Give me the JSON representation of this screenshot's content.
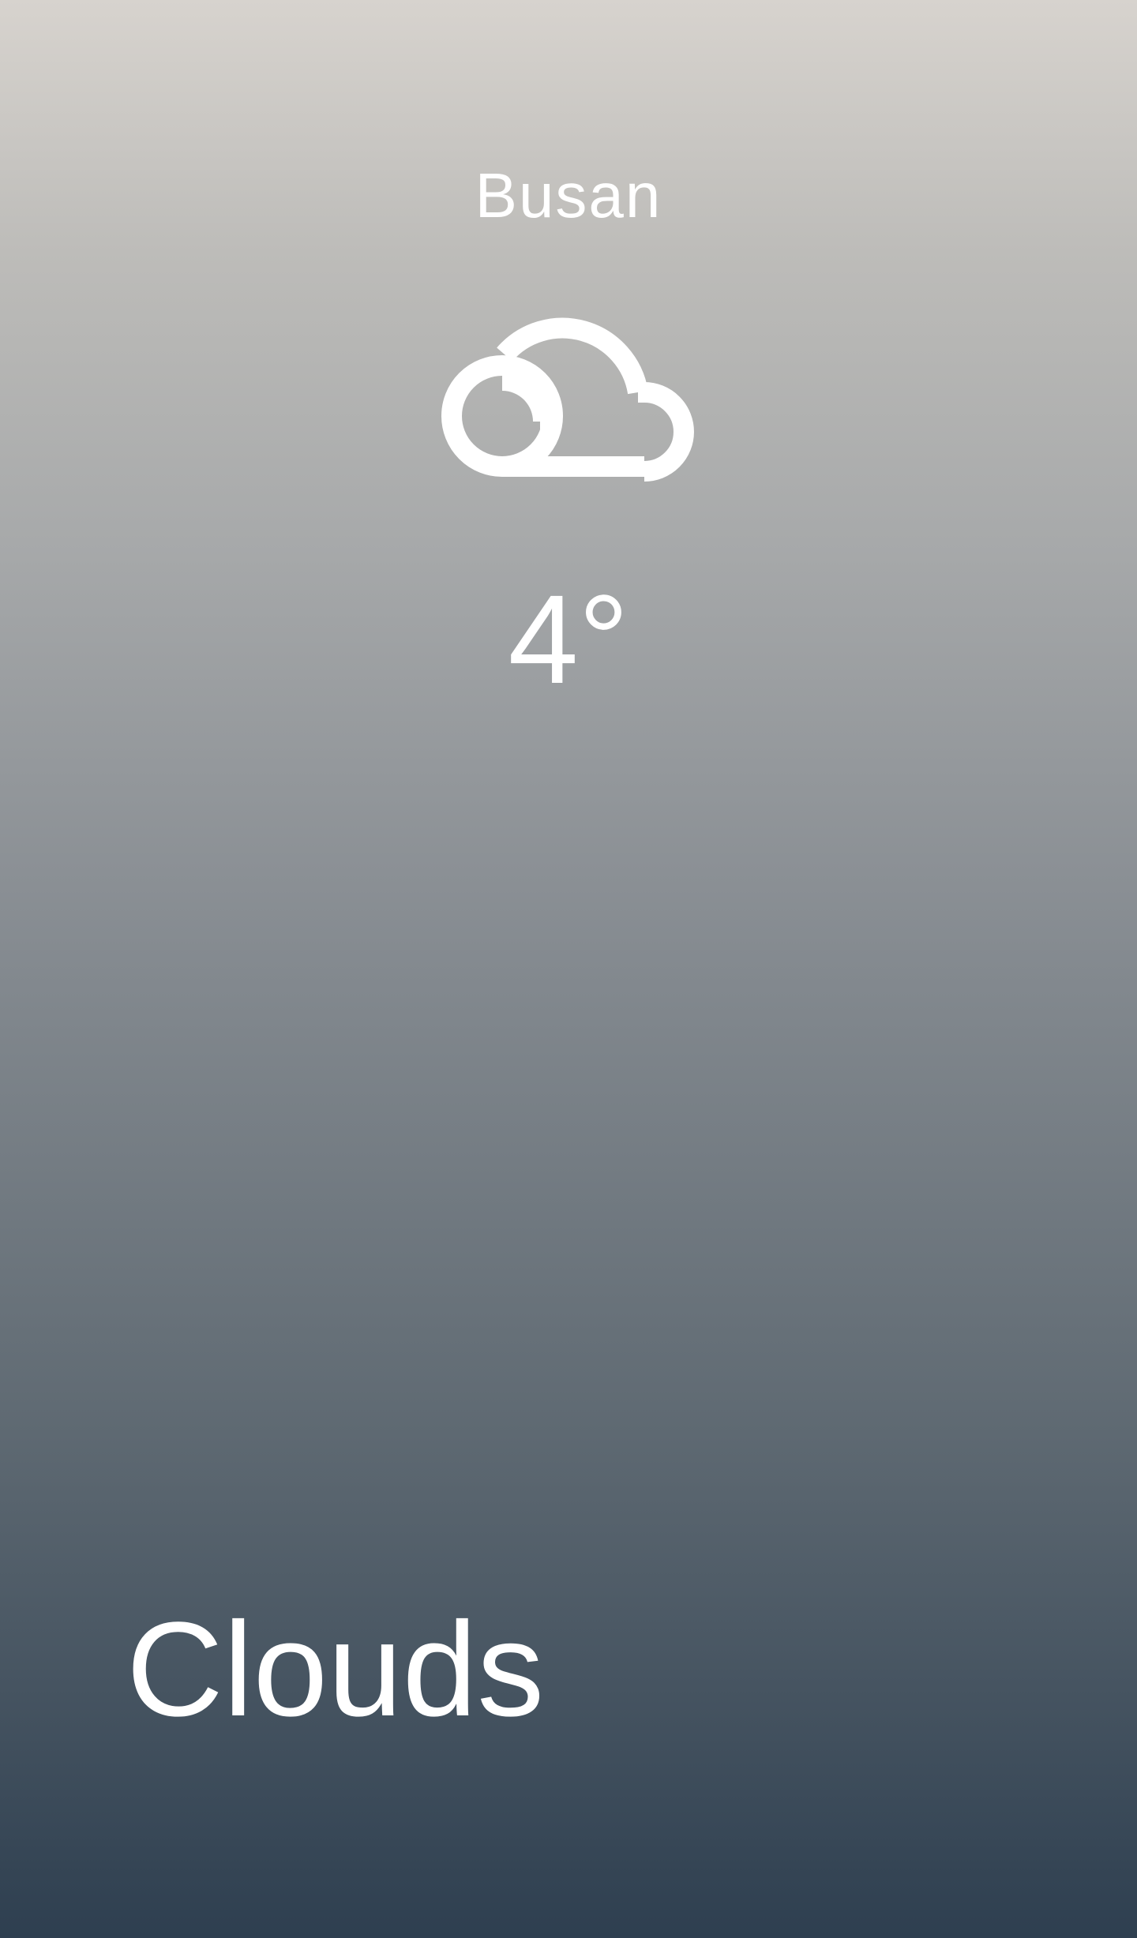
{
  "location": {
    "city": "Busan"
  },
  "current": {
    "icon": "cloud-icon",
    "temperature": "4°",
    "condition": "Clouds"
  },
  "theme": {
    "gradient_top": "#d7d3ce",
    "gradient_bottom": "#2e3f50",
    "text_color": "#ffffff"
  }
}
